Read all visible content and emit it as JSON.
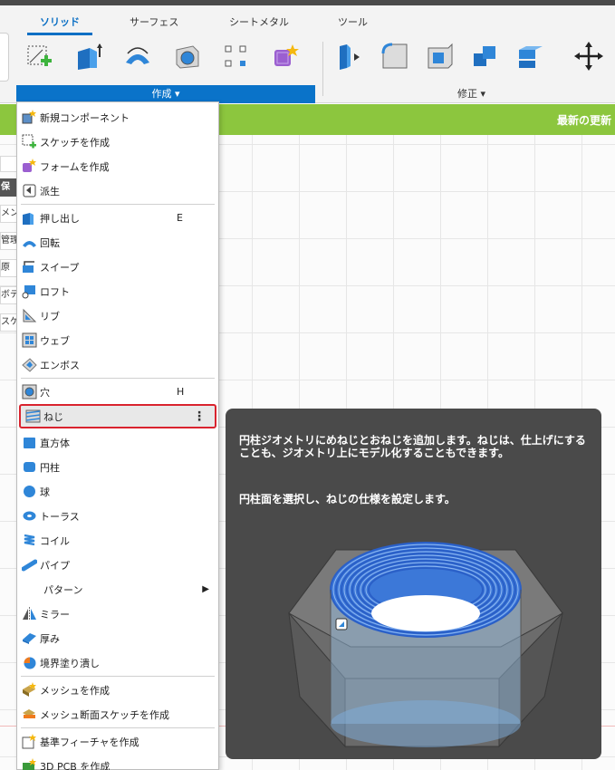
{
  "ribbon": {
    "tabs": [
      "ソリッド",
      "サーフェス",
      "シートメタル",
      "ツール"
    ],
    "active_tab": "ソリッド",
    "create_group_label": "作成 ▾",
    "modify_group_label": "修正 ▾"
  },
  "notification": {
    "text": "最新の更新"
  },
  "left_panel": {
    "items": [
      "保",
      "メン",
      "管理",
      "原",
      "ボデ",
      "スケ"
    ]
  },
  "menu": {
    "items": [
      {
        "label": "新規コンポーネント",
        "icon": "new-component-icon"
      },
      {
        "label": "スケッチを作成",
        "icon": "create-sketch-icon"
      },
      {
        "label": "フォームを作成",
        "icon": "create-form-icon"
      },
      {
        "label": "派生",
        "icon": "derive-icon"
      },
      {
        "label": "押し出し",
        "shortcut": "E",
        "icon": "extrude-icon"
      },
      {
        "label": "回転",
        "icon": "revolve-icon"
      },
      {
        "label": "スイープ",
        "icon": "sweep-icon"
      },
      {
        "label": "ロフト",
        "icon": "loft-icon"
      },
      {
        "label": "リブ",
        "icon": "rib-icon"
      },
      {
        "label": "ウェブ",
        "icon": "web-icon"
      },
      {
        "label": "エンボス",
        "icon": "emboss-icon"
      },
      {
        "label": "穴",
        "shortcut": "H",
        "icon": "hole-icon"
      },
      {
        "label": "ねじ",
        "more": "⋮",
        "icon": "thread-icon"
      },
      {
        "label": "直方体",
        "icon": "box-icon"
      },
      {
        "label": "円柱",
        "icon": "cylinder-icon"
      },
      {
        "label": "球",
        "icon": "sphere-icon"
      },
      {
        "label": "トーラス",
        "icon": "torus-icon"
      },
      {
        "label": "コイル",
        "icon": "coil-icon"
      },
      {
        "label": "パイプ",
        "icon": "pipe-icon"
      },
      {
        "label": "パターン",
        "arrow": "▶",
        "icon": "pattern-icon"
      },
      {
        "label": "ミラー",
        "icon": "mirror-icon"
      },
      {
        "label": "厚み",
        "icon": "thicken-icon"
      },
      {
        "label": "境界塗り潰し",
        "icon": "boundary-fill-icon"
      },
      {
        "label": "メッシュを作成",
        "icon": "create-mesh-icon"
      },
      {
        "label": "メッシュ断面スケッチを作成",
        "icon": "mesh-section-sketch-icon"
      },
      {
        "label": "基準フィーチャを作成",
        "icon": "base-feature-icon"
      },
      {
        "label": "3D PCB を作成",
        "icon": "pcb-icon"
      }
    ]
  },
  "tooltip": {
    "description": "円柱ジオメトリにめねじとおねじを追加します。ねじは、仕上げにすることも、ジオメトリ上にモデル化することもできます。",
    "hint": "円柱面を選択し、ねじの仕様を設定します。"
  },
  "colors": {
    "accent": "#0a73c9",
    "notification": "#8cc63e",
    "highlight_border": "#d9232e",
    "tooltip_bg": "#4a4a4a"
  }
}
